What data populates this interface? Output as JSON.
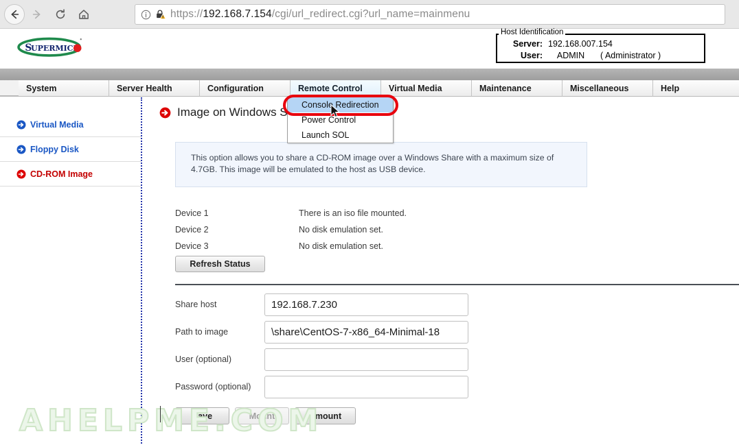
{
  "browser": {
    "back_icon": "arrow-left-icon",
    "forward_icon": "arrow-right-icon",
    "reload_icon": "reload-icon",
    "home_icon": "home-icon",
    "info_icon": "info-circle-icon",
    "security_icon": "lock-warning-icon",
    "url_scheme": "https://",
    "url_host": "192.168.7.154",
    "url_path": "/cgi/url_redirect.cgi?url_name=mainmenu",
    "url_full": "https://192.168.7.154/cgi/url_redirect.cgi?url_name=mainmenu"
  },
  "header": {
    "logo_text": "SUPERMICR",
    "logo_alt": "supermicro-logo",
    "host_identification": {
      "legend": "Host Identification",
      "server_label": "Server:",
      "server_value": "192.168.007.154",
      "user_label": "User:",
      "user_value": "ADMIN",
      "user_role": "( Administrator )"
    }
  },
  "nav": {
    "tabs": [
      {
        "label": "System",
        "active": false
      },
      {
        "label": "Server Health",
        "active": false
      },
      {
        "label": "Configuration",
        "active": false
      },
      {
        "label": "Remote Control",
        "active": true
      },
      {
        "label": "Virtual Media",
        "active": false
      },
      {
        "label": "Maintenance",
        "active": false
      },
      {
        "label": "Miscellaneous",
        "active": false
      },
      {
        "label": "Help",
        "active": false
      }
    ]
  },
  "dropdown": {
    "open_for": "Remote Control",
    "items": [
      {
        "label": "Console Redirection",
        "selected": true
      },
      {
        "label": "Power Control",
        "selected": false
      },
      {
        "label": "Launch SOL",
        "selected": false
      }
    ],
    "highlight_color": "#e8000d",
    "selected_bg": "#b5d5f5",
    "cursor_icon": "mouse-pointer-icon"
  },
  "sidebar": {
    "items": [
      {
        "label": "Virtual Media",
        "icon": "arrow-right-circle-icon",
        "color": "#1a57c4",
        "active": false
      },
      {
        "label": "Floppy Disk",
        "icon": "arrow-right-circle-icon",
        "color": "#1a57c4",
        "active": false
      },
      {
        "label": "CD-ROM Image",
        "icon": "arrow-right-circle-icon",
        "color": "#c30000",
        "active": true
      }
    ]
  },
  "main": {
    "title": "Image on Windows Share",
    "title_icon": "arrow-right-circle-icon",
    "info_text": "This option allows you to share a CD-ROM image over a Windows Share with a maximum size of 4.7GB. This image will be emulated to the host as USB device.",
    "devices": [
      {
        "name": "Device 1",
        "status": "There is an iso file mounted."
      },
      {
        "name": "Device 2",
        "status": "No disk emulation set."
      },
      {
        "name": "Device 3",
        "status": "No disk emulation set."
      }
    ],
    "refresh_label": "Refresh Status",
    "fields": [
      {
        "label": "Share host",
        "value": "192.168.7.230",
        "placeholder": ""
      },
      {
        "label": "Path to image",
        "value": "\\share\\CentOS-7-x86_64-Minimal-18",
        "placeholder": ""
      },
      {
        "label": "User (optional)",
        "value": "",
        "placeholder": ""
      },
      {
        "label": "Password (optional)",
        "value": "",
        "placeholder": ""
      }
    ],
    "buttons": [
      {
        "label": "Save",
        "disabled": false
      },
      {
        "label": "Mount",
        "disabled": true
      },
      {
        "label": "Umount",
        "disabled": false
      }
    ]
  },
  "watermark": {
    "text": "AHELPME.COM"
  }
}
